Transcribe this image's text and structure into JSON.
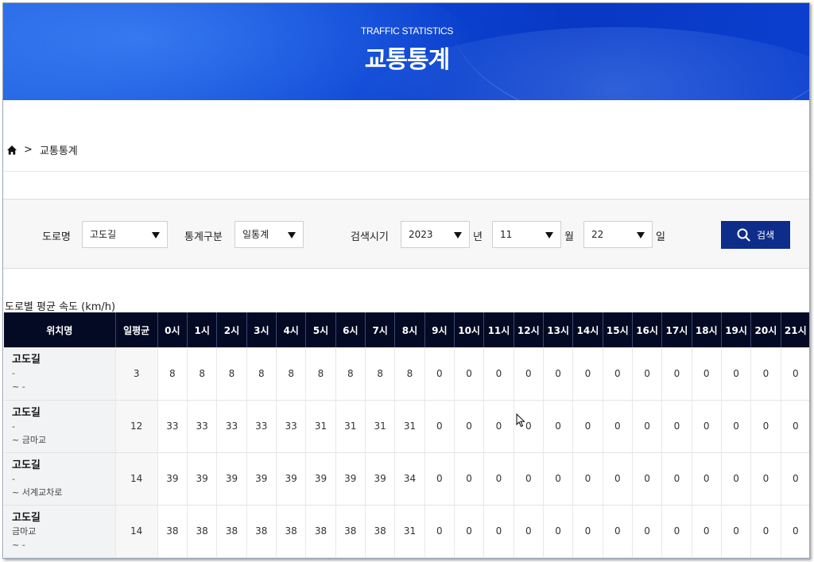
{
  "banner": {
    "subtitle": "TRAFFIC STATISTICS",
    "title": "교통통계"
  },
  "breadcrumb": {
    "separator": ">",
    "current": "교통통계"
  },
  "search": {
    "road_label": "도로명",
    "road_value": "고도길",
    "stat_label": "통계구분",
    "stat_value": "일통계",
    "period_label": "검색시기",
    "year_value": "2023",
    "year_unit": "년",
    "month_value": "11",
    "month_unit": "월",
    "day_value": "22",
    "day_unit": "일",
    "button_label": "검색"
  },
  "table": {
    "title": "도로별 평균 속도 (km/h)",
    "headers": [
      "위치명",
      "일평균",
      "0시",
      "1시",
      "2시",
      "3시",
      "4시",
      "5시",
      "6시",
      "7시",
      "8시",
      "9시",
      "10시",
      "11시",
      "12시",
      "13시",
      "14시",
      "15시",
      "16시",
      "17시",
      "18시",
      "19시",
      "20시",
      "21시"
    ],
    "rows": [
      {
        "name": "고도길",
        "from": "-",
        "to": "~ -",
        "avg": "3",
        "hours": [
          "8",
          "8",
          "8",
          "8",
          "8",
          "8",
          "8",
          "8",
          "8",
          "0",
          "0",
          "0",
          "0",
          "0",
          "0",
          "0",
          "0",
          "0",
          "0",
          "0",
          "0",
          "0"
        ]
      },
      {
        "name": "고도길",
        "from": "-",
        "to": "~ 금마교",
        "avg": "12",
        "hours": [
          "33",
          "33",
          "33",
          "33",
          "33",
          "31",
          "31",
          "31",
          "31",
          "0",
          "0",
          "0",
          "0",
          "0",
          "0",
          "0",
          "0",
          "0",
          "0",
          "0",
          "0",
          "0"
        ]
      },
      {
        "name": "고도길",
        "from": "-",
        "to": "~ 서계교차로",
        "avg": "14",
        "hours": [
          "39",
          "39",
          "39",
          "39",
          "39",
          "39",
          "39",
          "39",
          "34",
          "0",
          "0",
          "0",
          "0",
          "0",
          "0",
          "0",
          "0",
          "0",
          "0",
          "0",
          "0",
          "0"
        ]
      },
      {
        "name": "고도길",
        "from": "금마교",
        "to": "~ -",
        "avg": "14",
        "hours": [
          "38",
          "38",
          "38",
          "38",
          "38",
          "38",
          "38",
          "38",
          "31",
          "0",
          "0",
          "0",
          "0",
          "0",
          "0",
          "0",
          "0",
          "0",
          "0",
          "0",
          "0",
          "0"
        ]
      }
    ]
  },
  "colors": {
    "banner": "#0d47d6",
    "header_bg": "#050a24",
    "button_bg": "#0e2d8a"
  }
}
